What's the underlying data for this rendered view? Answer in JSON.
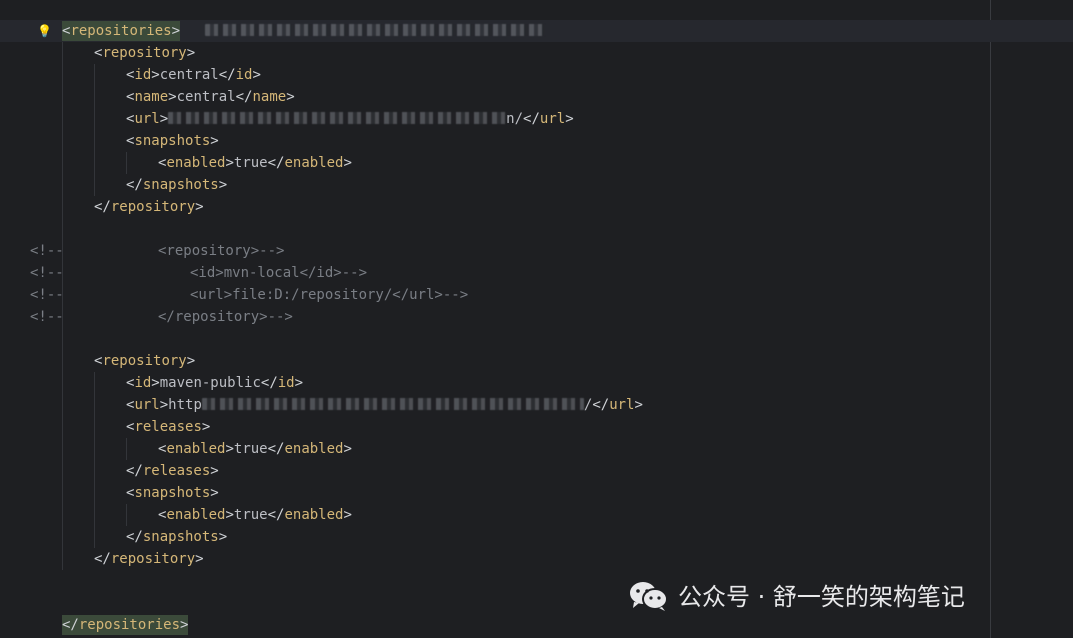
{
  "lines": [
    {
      "open": "repositories",
      "highlight": true,
      "blur_after": 340
    },
    {
      "open": "repository"
    },
    {
      "open": "id",
      "text": "central",
      "close": "id"
    },
    {
      "open": "name",
      "text": "central",
      "close": "name"
    },
    {
      "open": "url",
      "text": "n/",
      "close": "url",
      "blur_before": 338
    },
    {
      "open": "snapshots"
    },
    {
      "open": "enabled",
      "text": "true",
      "close": "enabled"
    },
    {
      "close": "snapshots"
    },
    {
      "close": "repository"
    },
    {},
    {
      "comment": "<repository>-->"
    },
    {
      "comment": "<id>mvn-local</id>-->"
    },
    {
      "comment": "<url>file:D:/repository/</url>-->"
    },
    {
      "comment": "</repository>-->"
    },
    {},
    {
      "open": "repository"
    },
    {
      "open": "id",
      "text": "maven-public",
      "close": "id"
    },
    {
      "open": "url",
      "text": "http",
      "close": "url",
      "blur_mid": 382
    },
    {
      "open": "releases"
    },
    {
      "open": "enabled",
      "text": "true",
      "close": "enabled"
    },
    {
      "close": "releases"
    },
    {
      "open": "snapshots"
    },
    {
      "open": "enabled",
      "text": "true",
      "close": "enabled"
    },
    {
      "close": "snapshots"
    },
    {
      "close": "repository"
    },
    {},
    {},
    {
      "close": "repositories",
      "highlight": true
    }
  ],
  "comment_marker": "<!--",
  "icons": {
    "intention": "lightbulb-icon",
    "watermark": "wechat-icon"
  },
  "watermark": {
    "text": "公众号 · 舒一笑的架构笔记"
  },
  "colors": {
    "background": "#1e1f22",
    "tag": "#d5b778",
    "bracket": "#cfd2d6",
    "text": "#bcbec4",
    "comment": "#7a7e85",
    "current_line": "#26282e"
  }
}
